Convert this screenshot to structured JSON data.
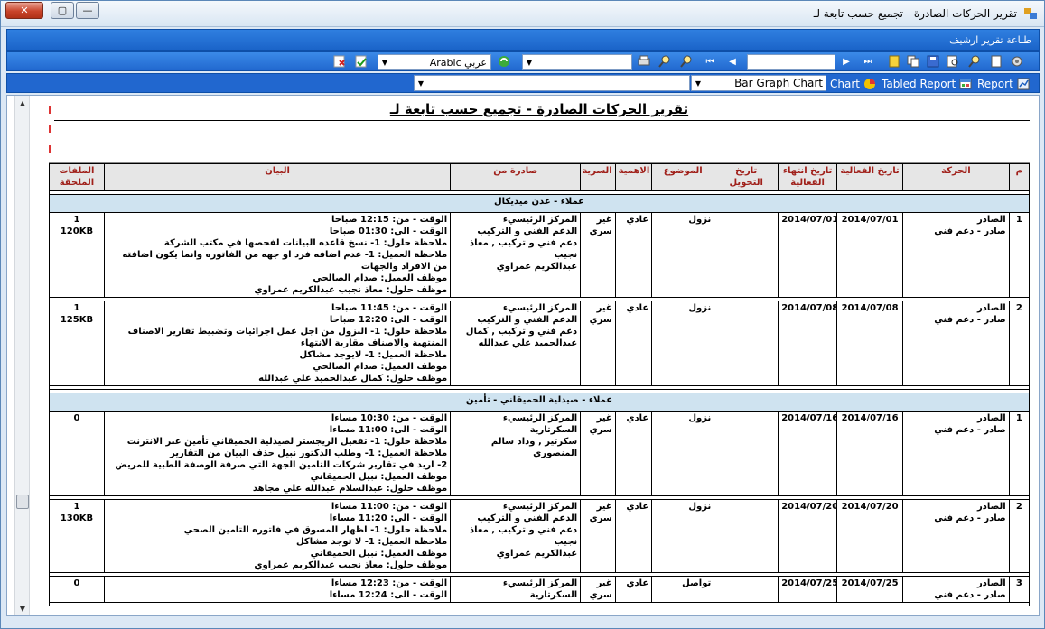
{
  "window": {
    "title": "تقرير الحركات الصادرة - تجميع حسب تابعة لـ",
    "close_label": "✕",
    "maximize_label": "▢",
    "minimize_label": "—"
  },
  "archive_link": "طباعة تقرير ارشيف",
  "toolbar": {
    "language_label": "Arabic عربي",
    "zoom_value": "",
    "page_input": ""
  },
  "tabs": [
    {
      "label": "Report",
      "icon": "report-icon"
    },
    {
      "label": "Tabled Report",
      "icon": "table-icon"
    },
    {
      "label": "Chart",
      "icon": "pie-chart-icon"
    },
    {
      "label": "Bar Graph Chart",
      "icon": "bar-chart-icon"
    }
  ],
  "report": {
    "title": "تقرير الحركات الصادرة - تجميع حسب تابعة لـ",
    "headers": [
      "م",
      "الحركة",
      "تاريخ الفعالية",
      "تاريخ انتهاء الفعالية",
      "تاريخ التحويل",
      "الموضوع",
      "الاهمية",
      "السرية",
      "صادرة من",
      "البيان",
      "الملفات الملحقة"
    ],
    "groups": [
      {
        "name": "عملاء - عدن ميديكال",
        "rows": [
          {
            "num": "1",
            "movement": [
              "الصادر",
              "صادر - دعم فني"
            ],
            "eff_date": "2014/07/01",
            "end_date": "2014/07/01",
            "transfer_date": "",
            "subject": "نزول",
            "importance": "عادي",
            "secrecy": "غير سري",
            "from": [
              "المركز الرئيسيء",
              "الدعم الفني و التركيب",
              "دعم فني و تركيب , معاذ نجيب",
              "عبدالكريم عمراوي"
            ],
            "statement": [
              "الوقت - من: 12:15 صباحا",
              "الوقت - الى: 01:30 صباحا",
              "ملاحظة  حلول: 1- نسخ قاعده البيانات لفحصها في مكتب الشركة",
              "ملاحظة  العميل: 1- عدم اضافه فرد او جهه من الفاتوره وانما يكون اضافته من الافراد والجهات",
              "موظف العميل: صدام الصالحي",
              "موظف حلول: معاذ نجيب عبدالكريم عمراوي"
            ],
            "files": [
              "1",
              "120KB"
            ]
          },
          {
            "num": "2",
            "movement": [
              "الصادر",
              "صادر - دعم فني"
            ],
            "eff_date": "2014/07/08",
            "end_date": "2014/07/08",
            "transfer_date": "",
            "subject": "نزول",
            "importance": "عادي",
            "secrecy": "غير سري",
            "from": [
              "المركز الرئيسيء",
              "الدعم الفني و التركيب",
              "دعم فني و تركيب , كمال",
              "عبدالحميد علي عبدالله"
            ],
            "statement": [
              "الوقت - من: 11:45 صباحا",
              "الوقت - الى: 12:20 صباحا",
              "ملاحظة  حلول: 1- النزول من اجل عمل اجرائيات وتضبيط تقارير الاصناف المنتهية والاصناف مقاربة الانتهاء",
              "ملاحظة  العميل: 1- لايوجد مشاكل",
              "موظف العميل: صدام الصالحي",
              "موظف حلول: كمال عبدالحميد علي عبدالله"
            ],
            "files": [
              "1",
              "125KB"
            ]
          }
        ]
      },
      {
        "name": "عملاء - صيدلية الحميقاني - تأمين",
        "rows": [
          {
            "num": "1",
            "movement": [
              "الصادر",
              "صادر - دعم فني"
            ],
            "eff_date": "2014/07/16",
            "end_date": "2014/07/16",
            "transfer_date": "",
            "subject": "نزول",
            "importance": "عادي",
            "secrecy": "غير سري",
            "from": [
              "المركز الرئيسيء",
              "السكرتارية",
              "سكرتير , وداد سالم المنصوري"
            ],
            "statement": [
              "الوقت - من: 10:30 مساءا",
              "الوقت - الى: 11:00 مساءا",
              "ملاحظة  حلول: 1- تفعيل الريجستر لصيدلية الحميقاني تأمين عبر الانترنت",
              "ملاحظة  العميل: 1- وطلب الدكتور نبيل حذف البيان من التقارير",
              "2- اريد في تقارير شركات التامين الجهة التي صرفة الوصفة الطبية للمريض",
              "موظف العميل: نبيل الحميقاني",
              "موظف حلول: عبدالسلام عبدالله علي مجاهد"
            ],
            "files": [
              "0",
              ""
            ]
          },
          {
            "num": "2",
            "movement": [
              "الصادر",
              "صادر - دعم فني"
            ],
            "eff_date": "2014/07/20",
            "end_date": "2014/07/20",
            "transfer_date": "",
            "subject": "نزول",
            "importance": "عادي",
            "secrecy": "غير سري",
            "from": [
              "المركز الرئيسيء",
              "الدعم الفني و التركيب",
              "دعم فني و تركيب , معاذ نجيب",
              "عبدالكريم عمراوي"
            ],
            "statement": [
              "الوقت - من: 11:00 مساءا",
              "الوقت - الى: 11:20 مساءا",
              "ملاحظة  حلول: 1- اظهار المسوق في فاتوره التامين الصحي",
              "ملاحظة  العميل: 1- لا توجد مشاكل",
              "موظف العميل: نبيل الحميقاني",
              "موظف حلول: معاذ نجيب عبدالكريم عمراوي"
            ],
            "files": [
              "1",
              "130KB"
            ]
          },
          {
            "num": "3",
            "movement": [
              "الصادر",
              "صادر - دعم فني"
            ],
            "eff_date": "2014/07/25",
            "end_date": "2014/07/25",
            "transfer_date": "",
            "subject": "تواصل",
            "importance": "عادي",
            "secrecy": "غير سري",
            "from": [
              "المركز الرئيسيء",
              "السكرتارية"
            ],
            "statement": [
              "الوقت - من: 12:23 مساءا",
              "الوقت - الى: 12:24 مساءا"
            ],
            "files": [
              "0",
              ""
            ]
          }
        ]
      }
    ]
  }
}
